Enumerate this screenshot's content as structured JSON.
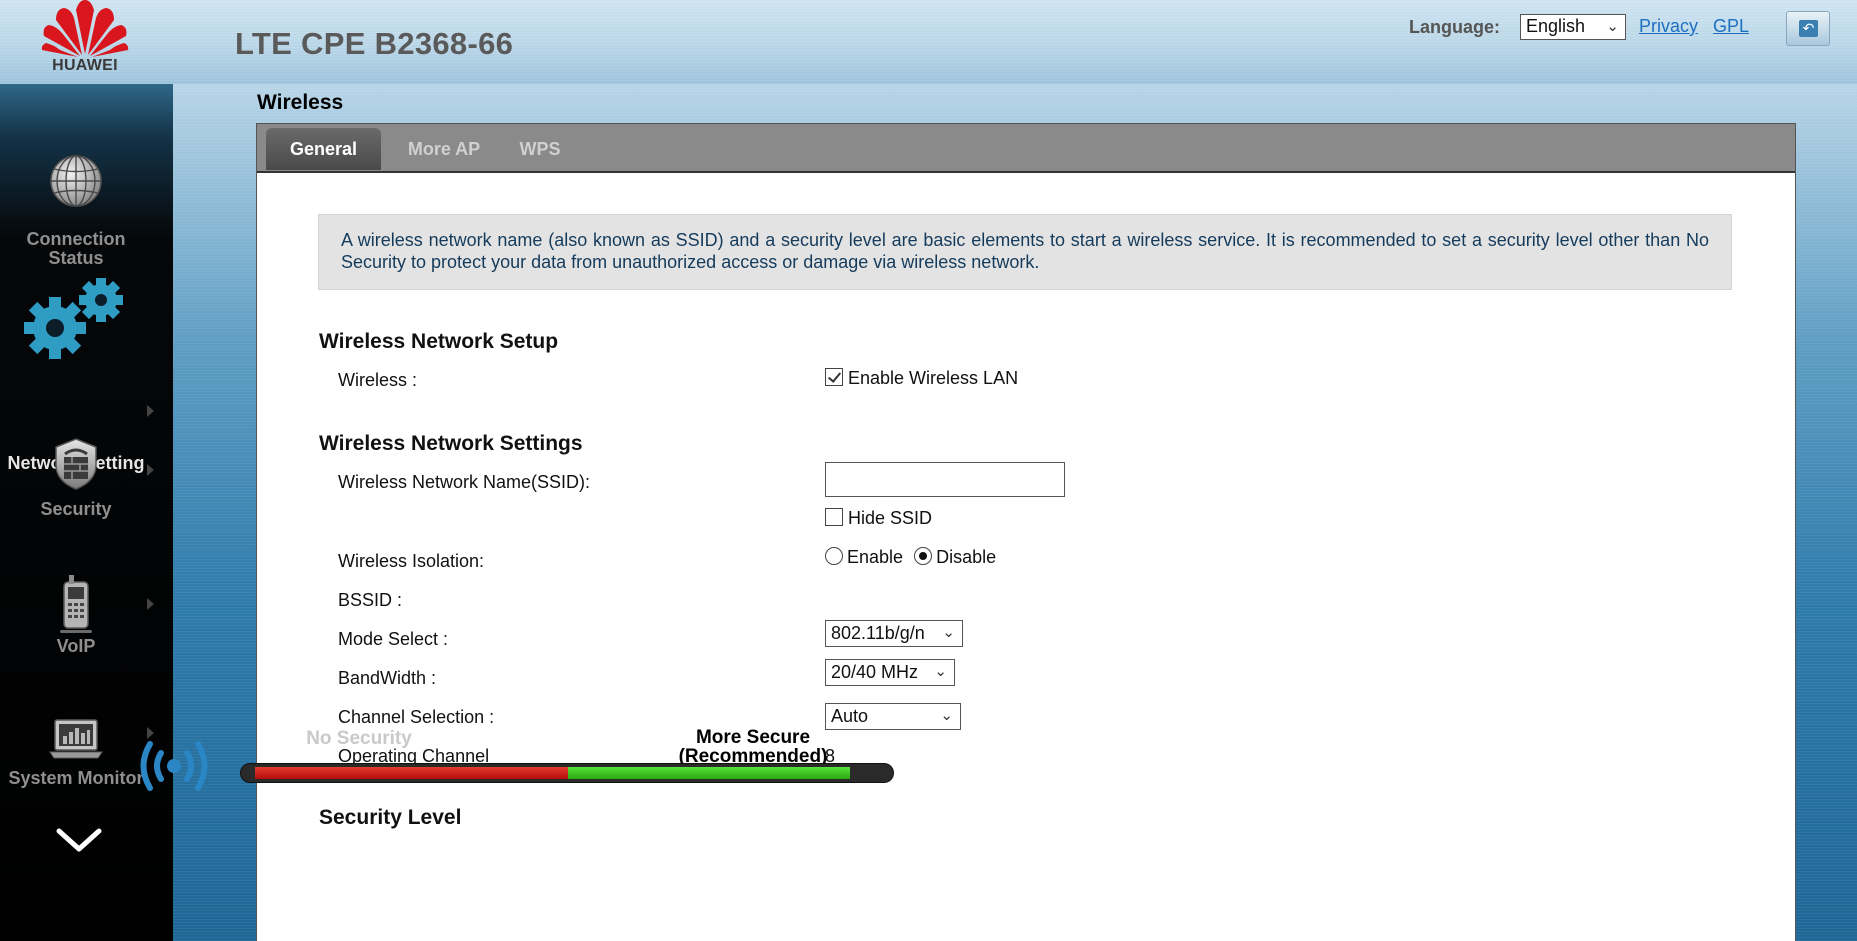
{
  "header": {
    "logo_text": "HUAWEI",
    "product_title": "LTE CPE B2368-66",
    "language_label": "Language:",
    "language_value": "English",
    "links": {
      "privacy": "Privacy",
      "gpl": "GPL"
    }
  },
  "sidebar": {
    "items": [
      {
        "label_line1": "Connection",
        "label_line2": "Status",
        "icon": "globe-icon"
      },
      {
        "label": "Network Setting",
        "icon": "gear-icon",
        "active": true
      },
      {
        "label": "Security",
        "icon": "shield-icon"
      },
      {
        "label": "VoIP",
        "icon": "phone-icon"
      },
      {
        "label": "System Monitor",
        "icon": "laptop-chart-icon"
      }
    ],
    "more_icon": "chevron-down-icon"
  },
  "page": {
    "title": "Wireless",
    "tabs": [
      {
        "label": "General",
        "active": true
      },
      {
        "label": "More AP"
      },
      {
        "label": "WPS"
      }
    ],
    "info_text": "A wireless network name (also known as SSID) and a security level are basic elements to start a wireless service. It is recommended to set a security level other than No Security to protect your data from unauthorized access or damage via wireless network.",
    "setup": {
      "title": "Wireless Network Setup",
      "wireless_label": "Wireless :",
      "enable_wlan_label": "Enable Wireless LAN",
      "enable_wlan_checked": true
    },
    "settings": {
      "title": "Wireless Network Settings",
      "ssid_label": "Wireless Network Name(SSID):",
      "ssid_value": "",
      "hide_ssid_label": "Hide SSID",
      "hide_ssid_checked": false,
      "isolation_label": "Wireless Isolation:",
      "isolation_enable": "Enable",
      "isolation_disable": "Disable",
      "isolation_selected": "Disable",
      "bssid_label": "BSSID :",
      "bssid_value": "",
      "mode_label": "Mode Select :",
      "mode_value": "802.11b/g/n",
      "bandwidth_label": "BandWidth :",
      "bandwidth_value": "20/40 MHz",
      "channel_label": "Channel Selection :",
      "channel_value": "Auto",
      "operating_channel_label": "Operating Channel",
      "operating_channel_value": "8"
    },
    "security": {
      "title": "Security Level",
      "no_security_label": "No Security",
      "more_secure_line1": "More Secure",
      "more_secure_line2": "(Recommended)",
      "level_percent": 95
    }
  },
  "colors": {
    "accent_blue": "#1d6fc2",
    "active_tab": "#4a4a4a",
    "info_text": "#153b5c",
    "slider_red": "#c0160f",
    "slider_green": "#3cc21d",
    "wifi_icon": "#2a86c4"
  }
}
